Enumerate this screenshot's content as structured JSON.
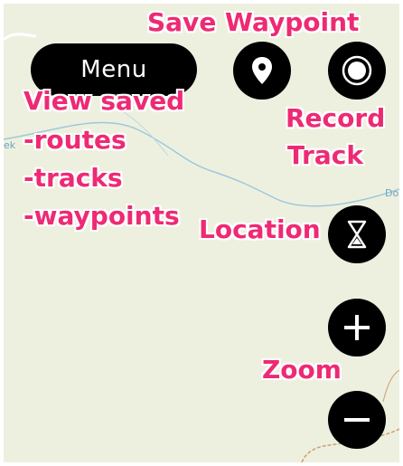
{
  "menu": {
    "label": "Menu"
  },
  "buttons": {
    "save_waypoint_icon": "map-pin-icon",
    "record_track_icon": "record-icon",
    "location_icon": "hourglass-icon",
    "zoom_in_icon": "plus-icon",
    "zoom_out_icon": "minus-icon"
  },
  "annotations": {
    "save_waypoint": "Save Waypoint",
    "view_saved": "View saved",
    "routes": "-routes",
    "tracks": "-tracks",
    "waypoints": "-waypoints",
    "record_1": "Record",
    "record_2": "Track",
    "location": "Location",
    "zoom": "Zoom"
  },
  "map_labels": {
    "left_fragment": "ek",
    "right_fragment": "Do"
  },
  "colors": {
    "annotation": "#ee2a74",
    "button": "#000000",
    "map_background": "#eef0df",
    "water": "#9cc8dd",
    "trail": "#c8a070"
  }
}
